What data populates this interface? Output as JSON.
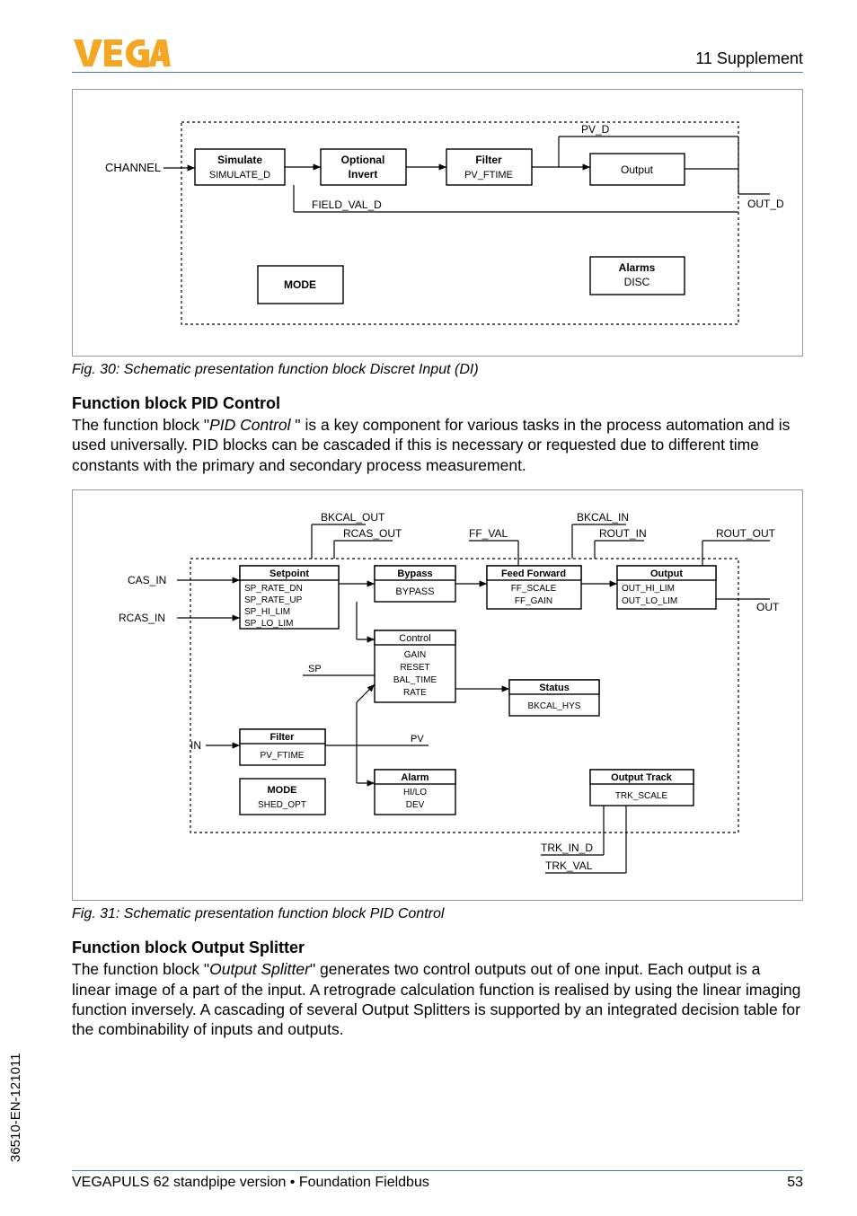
{
  "header": {
    "supplement": "11 Supplement"
  },
  "fig30": {
    "caption": "Fig. 30: Schematic presentation function block Discret Input (DI)",
    "labels": {
      "channel": "CHANNEL",
      "simulate_t": "Simulate",
      "simulate_b": "SIMULATE_D",
      "optional_t": "Optional",
      "optional_b": "Invert",
      "filter_t": "Filter",
      "filter_b": "PV_FTIME",
      "output": "Output",
      "alarms_t": "Alarms",
      "alarms_b": "DISC",
      "mode": "MODE",
      "field_val_d": "FIELD_VAL_D",
      "pv_d": "PV_D",
      "out_d": "OUT_D"
    }
  },
  "pid": {
    "title": "Function block PID Control",
    "text_pre": "The function block \"",
    "text_ital": "PID Control ",
    "text_post": "\" is a key component for various tasks in the process automation and is used universally. PID blocks can be cascaded if this is necessary or requested due to different time constants with the primary and secondary process measurement."
  },
  "fig31": {
    "caption": "Fig. 31: Schematic presentation function block PID Control",
    "labels": {
      "bkcal_out": "BKCAL_OUT",
      "rcas_out": "RCAS_OUT",
      "ff_val": "FF_VAL",
      "bkcal_in": "BKCAL_IN",
      "rout_in": "ROUT_IN",
      "rout_out": "ROUT_OUT",
      "cas_in": "CAS_IN",
      "rcas_in": "RCAS_IN",
      "setpoint": "Setpoint",
      "sp1": "SP_RATE_DN",
      "sp2": "SP_RATE_UP",
      "sp3": "SP_HI_LIM",
      "sp4": "SP_LO_LIM",
      "bypass_t": "Bypass",
      "bypass_b": "BYPASS",
      "ff_t": "Feed Forward",
      "ff1": "FF_SCALE",
      "ff2": "FF_GAIN",
      "output_t": "Output",
      "out1": "OUT_HI_LIM",
      "out2": "OUT_LO_LIM",
      "out": "OUT",
      "control": "Control",
      "c1": "GAIN",
      "c2": "RESET",
      "c3": "BAL_TIME",
      "c4": "RATE",
      "sp": "SP",
      "status_t": "Status",
      "status_b": "BKCAL_HYS",
      "filter_t": "Filter",
      "filter_b": "PV_FTIME",
      "in": "IN",
      "pv": "PV",
      "alarm_t": "Alarm",
      "alarm1": "HI/LO",
      "alarm2": "DEV",
      "mode_t": "MODE",
      "mode_b": "SHED_OPT",
      "track_t": "Output Track",
      "track_b": "TRK_SCALE",
      "trk_in_d": "TRK_IN_D",
      "trk_val": "TRK_VAL"
    }
  },
  "splitter": {
    "title": "Function block Output Splitter",
    "text_pre": "The function block \"",
    "text_ital": "Output Splitter",
    "text_post": "\" generates two control outputs out of one input. Each output is a linear image of a part of the input. A retrograde calculation function is realised by using the linear imaging function inversely. A cascading of several Output Splitters is supported by an integrated decision table for the combinability of inputs and outputs."
  },
  "side_label": "36510-EN-121011",
  "footer": {
    "left": "VEGAPULS 62 standpipe version • Foundation Fieldbus",
    "right": "53"
  }
}
